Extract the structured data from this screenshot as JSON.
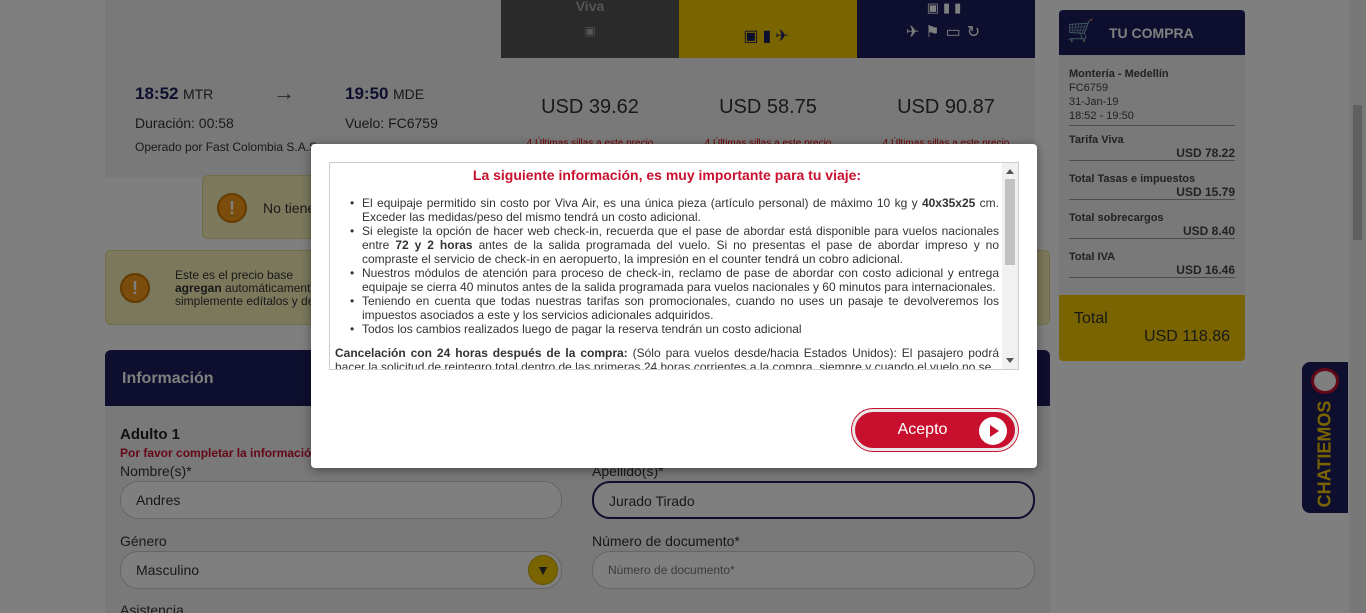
{
  "flight": {
    "dep_time": "18:52",
    "dep_code": "MTR",
    "arr_time": "19:50",
    "arr_code": "MDE",
    "duration": "Duración: 00:58",
    "flight_no": "Vuelo: FC6759",
    "operator": "Operado por Fast Colombia S.A.S"
  },
  "fares": [
    {
      "name": "Viva",
      "price": "USD 39.62",
      "note": "4 Últimas sillas a este precio",
      "color": "#555555"
    },
    {
      "name": "",
      "price": "USD 58.75",
      "note": "4 Últimas sillas a este precio",
      "color": "#f5c800"
    },
    {
      "name": "",
      "price": "USD 90.87",
      "note": "4 Últimas sillas a este precio",
      "color": "#1d1d5c"
    }
  ],
  "notice1": {
    "text": "No tiene"
  },
  "notice2": {
    "line1": "Este es el precio base",
    "bold": "agregan",
    "line2": " automáticament",
    "line3": "simplemente edítalos y de"
  },
  "form": {
    "header": "Información",
    "adult": "Adulto 1",
    "warning": "Por favor completar la información",
    "name_label": "Nombre(s)*",
    "name_value": "Andres",
    "surname_label": "Apellido(s)*",
    "surname_value": "Jurado Tirado",
    "gender_label": "Género",
    "gender_value": "Masculino",
    "doc_label": "Número de documento*",
    "doc_placeholder": "Número de documento*",
    "assist_label": "Asistencia"
  },
  "sidebar": {
    "title": "TU COMPRA",
    "route": "Montería - Medellín",
    "flight": "FC6759",
    "date": "31-Jan-19",
    "times": "18:52 - 19:50",
    "rows": [
      {
        "label": "Tarifa Viva",
        "value": "USD 78.22"
      },
      {
        "label": "Total Tasas e impuestos",
        "value": "USD 15.79"
      },
      {
        "label": "Total sobrecargos",
        "value": "USD 8.40"
      },
      {
        "label": "Total IVA",
        "value": "USD 16.46"
      }
    ],
    "total_label": "Total",
    "total_value": "USD 118.86"
  },
  "chat": {
    "label": "CHATIEMOS"
  },
  "modal": {
    "title": "La siguiente información, es muy importante para tu viaje:",
    "b1a": "El equipaje permitido sin costo por Viva Air, es una única pieza (artículo personal) de máximo 10 kg y ",
    "b1b": "40x35x25",
    "b1c": " cm. Exceder las medidas/peso del mismo tendrá un costo adicional.",
    "b2a": "Si elegiste la opción de hacer web check-in, recuerda que el pase de abordar está disponible para vuelos nacionales entre ",
    "b2b": "72 y 2 horas",
    "b2c": " antes de la salida programada del  vuelo. Si no presentas el pase de abordar impreso y no compraste el servicio de check-in en aeropuerto, la impresión en el counter tendrá un cobro adicional.",
    "b3": "Nuestros módulos de atención para proceso de check-in, reclamo de pase de abordar con costo adicional y entrega equipaje se cierra 40 minutos antes de la salida programada para vuelos nacionales y 60 minutos para internacionales.",
    "b4": "Teniendo en cuenta que todas nuestras tarifas son promocionales, cuando no uses un pasaje te devolveremos los impuestos asociados a este y los servicios adicionales adquiridos.",
    "b5": "Todos los cambios realizados luego de pagar la reserva tendrán un costo adicional",
    "cancel_bold": "Cancelación con 24 horas después de la compra:",
    "cancel_text": " (Sólo para vuelos desde/hacia Estados Unidos): El pasajero podrá hacer la solicitud de reintegro total dentro de las primeras 24 horas corrientes a la compra, siempre y cuando el vuelo no se",
    "accept": "Acepto"
  }
}
